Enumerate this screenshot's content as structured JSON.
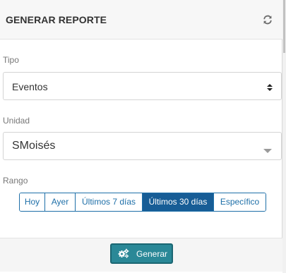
{
  "header": {
    "title": "GENERAR REPORTE",
    "refresh_icon": "refresh-icon"
  },
  "tipo": {
    "label": "Tipo",
    "value": "Eventos",
    "icon": "sort-arrows-icon"
  },
  "unidad": {
    "label": "Unidad",
    "value": "SMoisés",
    "icon": "caret-down-icon"
  },
  "rango": {
    "label": "Rango",
    "options": [
      "Hoy",
      "Ayer",
      "Últimos 7 días",
      "Últimos 30 días",
      "Específico"
    ],
    "selected": "Últimos 30 días"
  },
  "footer": {
    "generate_label": "Generar",
    "generate_icon": "cogs-icon"
  },
  "colors": {
    "primary": "#175d96",
    "button_teal": "#2a8897",
    "header_bg": "#f7f7f7"
  }
}
